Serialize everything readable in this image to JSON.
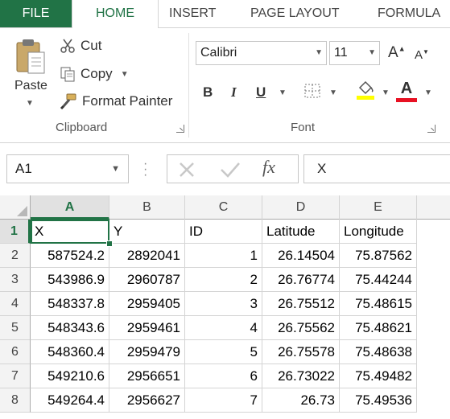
{
  "ribbon": {
    "tabs": [
      "FILE",
      "HOME",
      "INSERT",
      "PAGE LAYOUT",
      "FORMULA"
    ],
    "active_tab": "HOME",
    "clipboard": {
      "paste": "Paste",
      "cut": "Cut",
      "copy": "Copy",
      "format_painter": "Format Painter",
      "group_label": "Clipboard"
    },
    "font": {
      "name": "Calibri",
      "size": "11",
      "grow": "A",
      "shrink": "A",
      "bold": "B",
      "italic": "I",
      "underline": "U",
      "font_color_glyph": "A",
      "group_label": "Font"
    },
    "colors": {
      "accent": "#217346",
      "highlight": "#ffff00",
      "font_color": "#e81123"
    }
  },
  "formula_bar": {
    "name_box": "A1",
    "fx": "fx",
    "value": "X"
  },
  "sheet": {
    "columns": [
      "A",
      "B",
      "C",
      "D",
      "E"
    ],
    "selected_column": "A",
    "selected_row": "1",
    "rows": [
      {
        "num": "1",
        "cells": [
          "X",
          "Y",
          "ID",
          "Latitude",
          "Longitude"
        ]
      },
      {
        "num": "2",
        "cells": [
          "587524.2",
          "2892041",
          "1",
          "26.14504",
          "75.87562"
        ]
      },
      {
        "num": "3",
        "cells": [
          "543986.9",
          "2960787",
          "2",
          "26.76774",
          "75.44244"
        ]
      },
      {
        "num": "4",
        "cells": [
          "548337.8",
          "2959405",
          "3",
          "26.75512",
          "75.48615"
        ]
      },
      {
        "num": "5",
        "cells": [
          "548343.6",
          "2959461",
          "4",
          "26.75562",
          "75.48621"
        ]
      },
      {
        "num": "6",
        "cells": [
          "548360.4",
          "2959479",
          "5",
          "26.75578",
          "75.48638"
        ]
      },
      {
        "num": "7",
        "cells": [
          "549210.6",
          "2956651",
          "6",
          "26.73022",
          "75.49482"
        ]
      },
      {
        "num": "8",
        "cells": [
          "549264.4",
          "2956627",
          "7",
          "26.73",
          "75.49536"
        ]
      }
    ]
  }
}
